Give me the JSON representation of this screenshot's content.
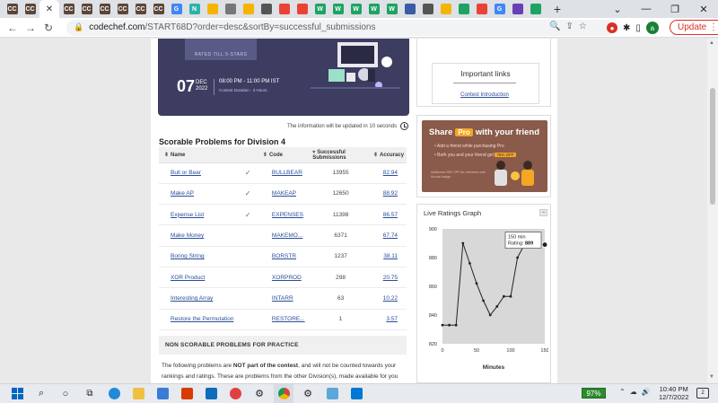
{
  "browser": {
    "tabs": [
      {
        "label": "CC",
        "color": "#5b4638"
      },
      {
        "label": "CC",
        "color": "#5b4638"
      },
      {
        "label": "CC",
        "color": "#5b4638"
      },
      {
        "label": "CC",
        "color": "#5b4638"
      },
      {
        "label": "CC",
        "color": "#5b4638"
      },
      {
        "label": "CC",
        "color": "#5b4638"
      },
      {
        "label": "CC",
        "color": "#5b4638"
      },
      {
        "label": "CC",
        "color": "#5b4638"
      },
      {
        "label": "CC",
        "color": "#5b4638"
      },
      {
        "label": "G",
        "color": "#4285f4"
      },
      {
        "label": "N",
        "color": "#2bb3a8"
      },
      {
        "label": "",
        "color": "#f4b400"
      },
      {
        "label": "",
        "color": "#777777"
      },
      {
        "label": "",
        "color": "#f4b400"
      },
      {
        "label": "",
        "color": "#555555"
      },
      {
        "label": "",
        "color": "#ea4335"
      },
      {
        "label": "",
        "color": "#ea4335"
      },
      {
        "label": "W",
        "color": "#1da462"
      },
      {
        "label": "W",
        "color": "#1da462"
      },
      {
        "label": "W",
        "color": "#1da462"
      },
      {
        "label": "W",
        "color": "#1da462"
      },
      {
        "label": "W",
        "color": "#1da462"
      },
      {
        "label": "",
        "color": "#3b5ba5"
      },
      {
        "label": "",
        "color": "#555555"
      },
      {
        "label": "",
        "color": "#f4b400"
      },
      {
        "label": "",
        "color": "#1da462"
      },
      {
        "label": "",
        "color": "#ea4335"
      },
      {
        "label": "G",
        "color": "#4285f4"
      },
      {
        "label": "",
        "color": "#6a3fb5"
      },
      {
        "label": "",
        "color": "#1da462"
      }
    ],
    "active_tab_index": 2,
    "new_tab": "+",
    "url_host": "codechef.com",
    "url_path": "/START68D?order=desc&sortBy=successful_submissions",
    "update_label": "Update",
    "avatar_letter": "a"
  },
  "banner": {
    "rated": "RATED TILL 5-STARS",
    "day": "07",
    "month": "DEC",
    "year": "2022",
    "time": "08:00 PM - 11:00 PM IST",
    "duration": "Contest Duration - 3 Hours"
  },
  "update_note": "The information will be updated in 10 seconds",
  "section_title": "Scorable Problems for Division 4",
  "table": {
    "headers": {
      "name": "Name",
      "code": "Code",
      "submissions": "Successful Submissions",
      "accuracy": "Accuracy"
    },
    "rows": [
      {
        "name": "Bull or Bear",
        "solved": true,
        "code": "BULLBEAR",
        "submissions": "13955",
        "accuracy": "82.94"
      },
      {
        "name": "Make AP",
        "solved": true,
        "code": "MAKEAP",
        "submissions": "12650",
        "accuracy": "88.92"
      },
      {
        "name": "Expense List",
        "solved": true,
        "code": "EXPENSES",
        "submissions": "11398",
        "accuracy": "86.57"
      },
      {
        "name": "Make Money",
        "solved": false,
        "code": "MAKEMO...",
        "submissions": "6371",
        "accuracy": "67.74"
      },
      {
        "name": "Boring String",
        "solved": false,
        "code": "BORSTR",
        "submissions": "1237",
        "accuracy": "38.11"
      },
      {
        "name": "XOR Product",
        "solved": false,
        "code": "XORPROD",
        "submissions": "298",
        "accuracy": "20.75"
      },
      {
        "name": "Interesting Array",
        "solved": false,
        "code": "INTARR",
        "submissions": "63",
        "accuracy": "10.22"
      },
      {
        "name": "Restore the Permutation",
        "solved": false,
        "code": "RESTORE...",
        "submissions": "1",
        "accuracy": "3.57"
      }
    ],
    "check_glyph": "✓"
  },
  "non_scorable": {
    "title": "NON SCORABLE PROBLEMS FOR PRACTICE",
    "desc_pre": "The following problems are ",
    "desc_bold": "NOT part of the contest",
    "desc_post": ", and will not be counted towards your rankings and ratings. These are problems from the other Division(s), made available for you"
  },
  "important_links": {
    "title": "Important links",
    "link": "Contest Introduction"
  },
  "share": {
    "pre": "Share",
    "pro": "Pro",
    "post": "with your friend",
    "line1": "• Add a friend while purchasing Pro",
    "line2": "• Both you and your friend get",
    "off": "75% OFF",
    "fine": "Additional 25% OFF for members with Annual badge"
  },
  "live_ratings": {
    "title": "Live Ratings Graph",
    "collapse": "−",
    "tooltip_line1": "150 min",
    "tooltip_line2_label": "Rating: ",
    "tooltip_line2_value": "889"
  },
  "chart_data": {
    "type": "line",
    "x": [
      0,
      10,
      20,
      30,
      40,
      50,
      60,
      70,
      80,
      90,
      100,
      110,
      120,
      130,
      140,
      150
    ],
    "y": [
      833,
      833,
      833,
      890,
      876,
      862,
      850,
      840,
      846,
      853,
      853,
      880,
      889,
      889,
      889,
      889
    ],
    "xlabel": "Minutes",
    "ylabel": "",
    "xticks": [
      0,
      50,
      100,
      150
    ],
    "yticks": [
      820,
      840,
      860,
      880,
      900
    ],
    "xlim": [
      0,
      150
    ],
    "ylim": [
      820,
      900
    ],
    "highlight": {
      "x": 150,
      "y": 889
    },
    "background": "#d8d8d8",
    "line_color": "#222222"
  },
  "taskbar": {
    "battery": "97%",
    "time": "10:40 PM",
    "date": "12/7/2022",
    "notifications": "2"
  }
}
